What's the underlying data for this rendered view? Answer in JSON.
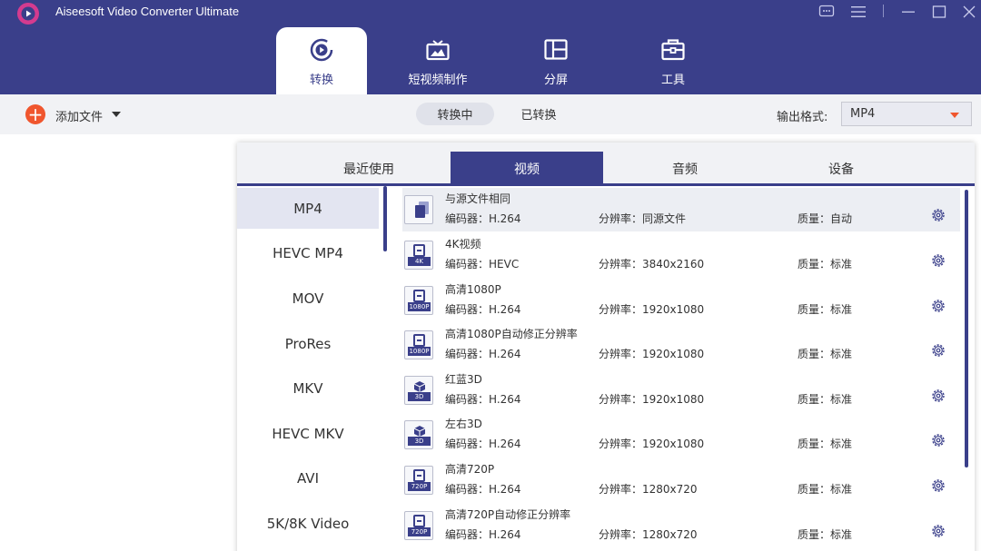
{
  "app": {
    "title": "Aiseesoft Video Converter Ultimate",
    "accent_color": "#3a3f8a",
    "brand_color": "#f0562e"
  },
  "window_controls": [
    "feedback-icon",
    "menu-icon",
    "minimize-icon",
    "maximize-icon",
    "close-icon"
  ],
  "main_tabs": [
    {
      "label": "转换",
      "icon": "convert-icon",
      "active": true
    },
    {
      "label": "短视频制作",
      "icon": "mv-icon",
      "active": false
    },
    {
      "label": "分屏",
      "icon": "collage-icon",
      "active": false
    },
    {
      "label": "工具",
      "icon": "toolbox-icon",
      "active": false
    }
  ],
  "toolbar": {
    "add_files_label": "添加文件",
    "converting_tab": "转换中",
    "converted_tab": "已转换",
    "output_format_label": "输出格式:",
    "output_format_value": "MP4"
  },
  "format_panel": {
    "categories": [
      {
        "label": "最近使用",
        "active": false
      },
      {
        "label": "视频",
        "active": true
      },
      {
        "label": "音频",
        "active": false
      },
      {
        "label": "设备",
        "active": false
      }
    ],
    "formats": [
      {
        "label": "MP4",
        "active": true
      },
      {
        "label": "HEVC MP4",
        "active": false
      },
      {
        "label": "MOV",
        "active": false
      },
      {
        "label": "ProRes",
        "active": false
      },
      {
        "label": "MKV",
        "active": false
      },
      {
        "label": "HEVC MKV",
        "active": false
      },
      {
        "label": "AVI",
        "active": false
      },
      {
        "label": "5K/8K Video",
        "active": false
      }
    ],
    "presets": [
      {
        "name": "与源文件相同",
        "encoder": "编码器：H.264",
        "resolution": "分辨率：同源文件",
        "quality": "质量：自动",
        "icon": "same-as-source-icon",
        "badge": "",
        "active": true
      },
      {
        "name": "4K视频",
        "encoder": "编码器：HEVC",
        "resolution": "分辨率：3840x2160",
        "quality": "质量：标准",
        "icon": "video-4k-icon",
        "badge": "4K",
        "active": false
      },
      {
        "name": "高清1080P",
        "encoder": "编码器：H.264",
        "resolution": "分辨率：1920x1080",
        "quality": "质量：标准",
        "icon": "video-1080p-icon",
        "badge": "1080P",
        "active": false
      },
      {
        "name": "高清1080P自动修正分辨率",
        "encoder": "编码器：H.264",
        "resolution": "分辨率：1920x1080",
        "quality": "质量：标准",
        "icon": "video-1080p-icon",
        "badge": "1080P",
        "active": false
      },
      {
        "name": "红蓝3D",
        "encoder": "编码器：H.264",
        "resolution": "分辨率：1920x1080",
        "quality": "质量：标准",
        "icon": "video-3d-icon",
        "badge": "3D",
        "active": false
      },
      {
        "name": "左右3D",
        "encoder": "编码器：H.264",
        "resolution": "分辨率：1920x1080",
        "quality": "质量：标准",
        "icon": "video-3d-icon",
        "badge": "3D",
        "active": false
      },
      {
        "name": "高清720P",
        "encoder": "编码器：H.264",
        "resolution": "分辨率：1280x720",
        "quality": "质量：标准",
        "icon": "video-720p-icon",
        "badge": "720P",
        "active": false
      },
      {
        "name": "高清720P自动修正分辨率",
        "encoder": "编码器：H.264",
        "resolution": "分辨率：1280x720",
        "quality": "质量：标准",
        "icon": "video-720p-icon",
        "badge": "720P",
        "active": false
      }
    ]
  }
}
